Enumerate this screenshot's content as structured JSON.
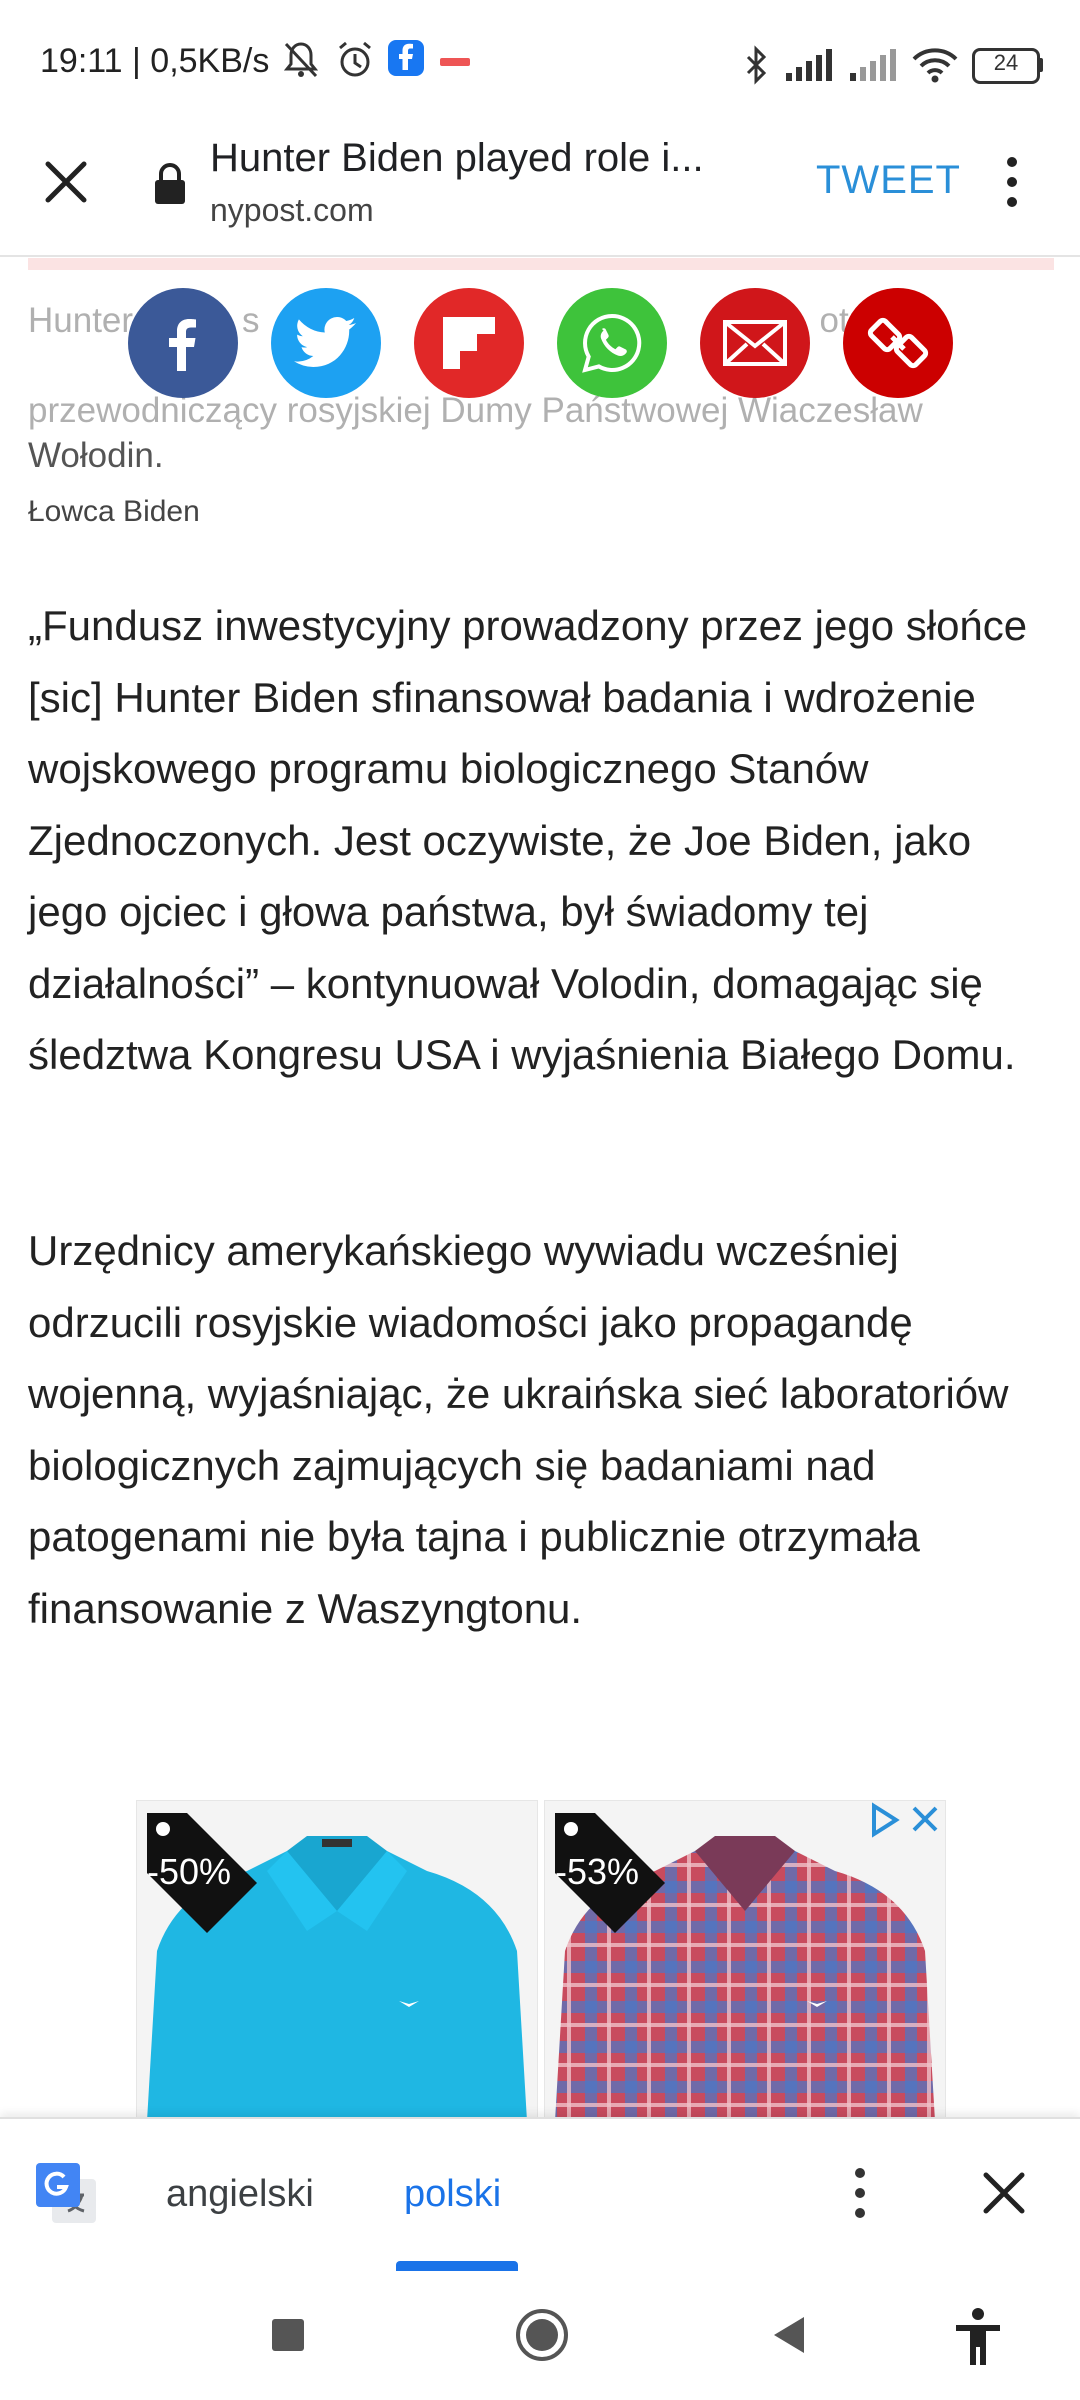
{
  "status_bar": {
    "time_speed": "19:11 | 0,5KB/s",
    "battery": "24"
  },
  "toolbar": {
    "title": "Hunter Biden played role i...",
    "domain": "nypost.com",
    "tweet_label": "TWEET"
  },
  "share_icons": [
    "facebook-icon",
    "twitter-icon",
    "flipboard-icon",
    "whatsapp-icon",
    "email-icon",
    "link-icon"
  ],
  "article": {
    "caption_line1": "Hunter Biden s",
    "caption_line1_end": "otrz",
    "caption_rest": "przewodniczący rosyjskiej Dumy Państwowej Wiaczesław",
    "caption_last": "Wołodin.",
    "credit": "Łowca Biden",
    "paragraph1": "„Fundusz inwestycyjny prowadzony przez jego słońce [sic] Hunter Biden sfinansował badania i wdrożenie wojskowego programu biologicznego Stanów Zjednoczonych. Jest oczywiste, że Joe Biden, jako jego ojciec i głowa państwa, był świadomy tej działalności” – kontynuował Volodin, domagając się śledztwa Kongresu USA i wyjaśnienia Białego Domu.",
    "paragraph2": "Urzędnicy amerykańskiego wywiadu wcześniej odrzucili rosyjskie wiadomości jako propagandę wojenną, wyjaśniając, że ukraińska sieć laboratoriów biologicznych zajmujących się badaniami nad patogenami nie była tajna i publicznie otrzymała finansowanie z Waszyngtonu."
  },
  "ads": [
    {
      "discount": "-50%",
      "color": "#1fb7e3"
    },
    {
      "discount": "-53%",
      "color": "#c04a5a"
    }
  ],
  "translate_bar": {
    "source_lang": "angielski",
    "target_lang": "polski"
  },
  "colors": {
    "facebook": "#3b5998",
    "twitter": "#1da1f2",
    "flipboard": "#e12828",
    "whatsapp": "#3ec33b",
    "email": "#d0161a",
    "link": "#cc0000",
    "accent_blue": "#1a73e8"
  }
}
